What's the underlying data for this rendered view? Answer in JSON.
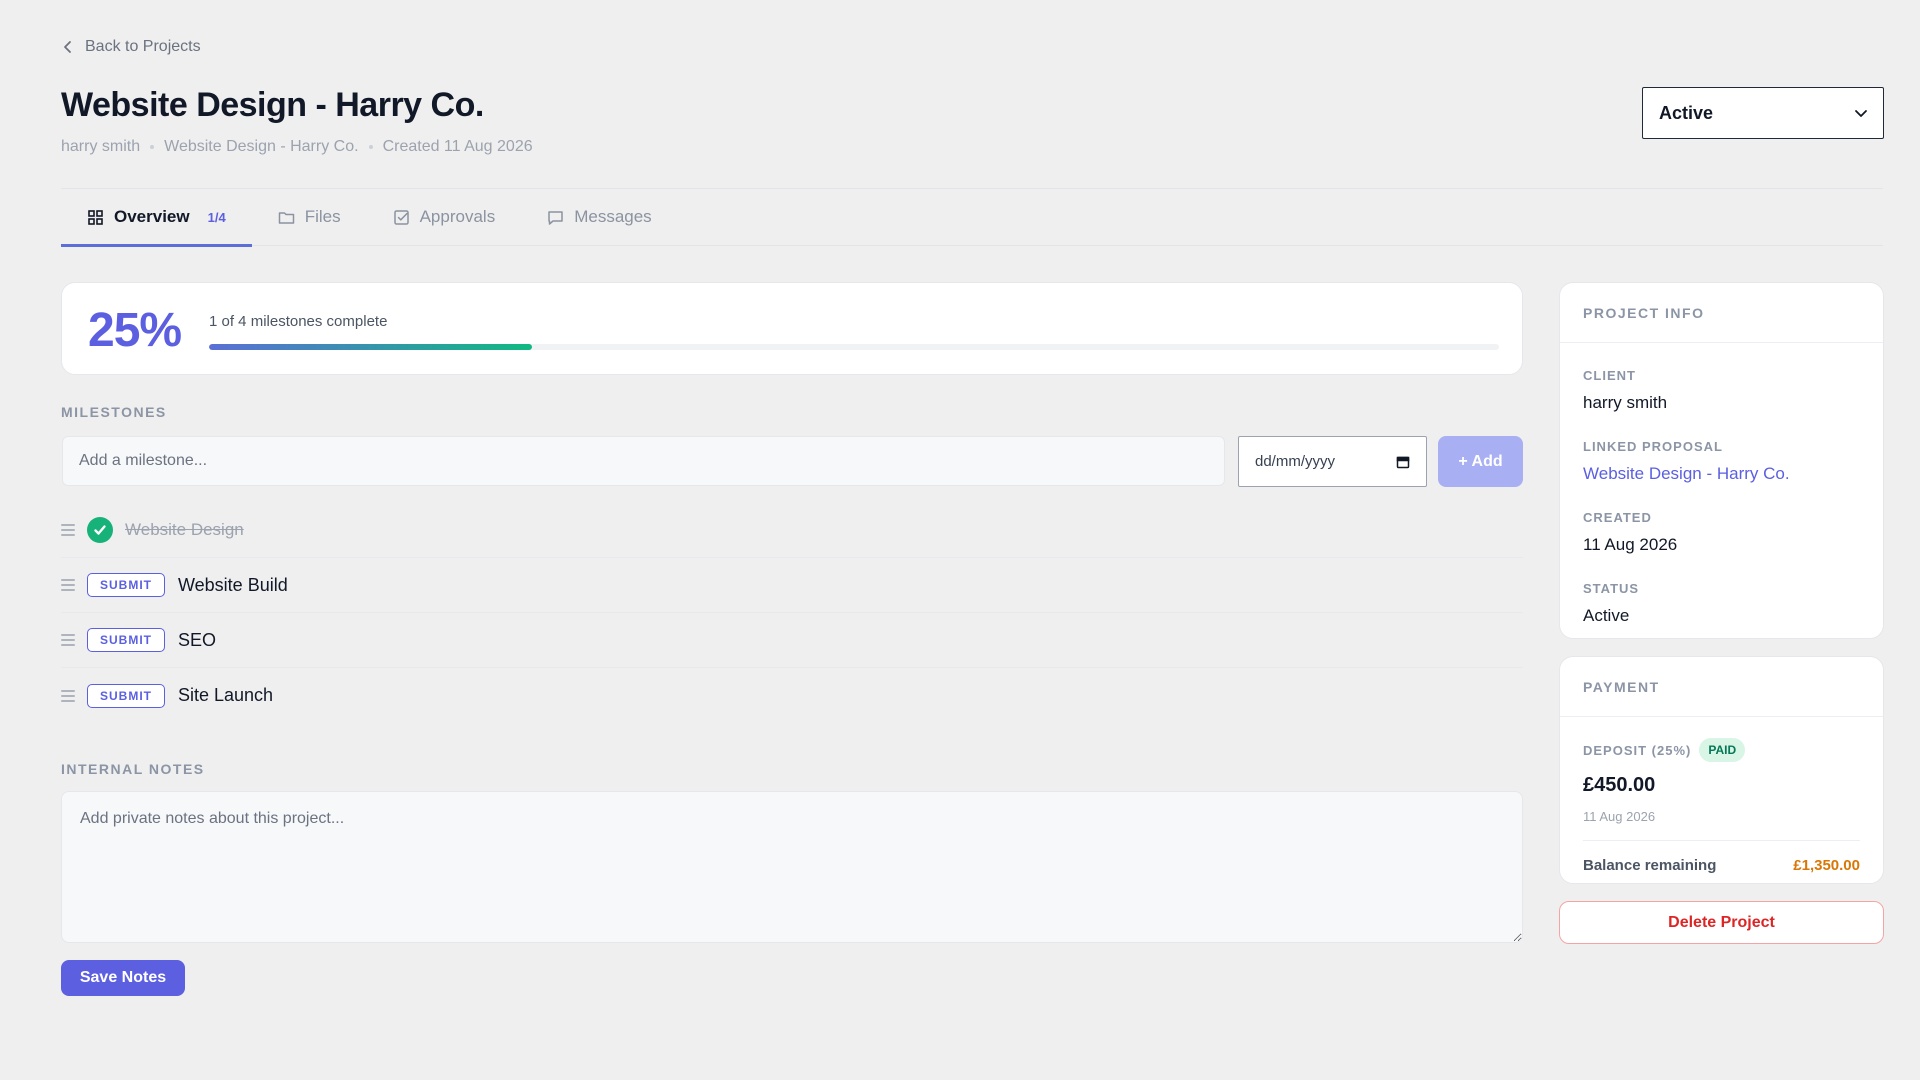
{
  "nav": {
    "back_label": "Back to Projects"
  },
  "project": {
    "title": "Website Design - Harry Co.",
    "meta_client": "harry smith",
    "meta_proposal": "Website Design - Harry Co.",
    "meta_created": "Created 11 Aug 2026",
    "status_value": "Active"
  },
  "tabs": [
    {
      "label": "Overview",
      "count": "1/4",
      "icon": "grid-icon",
      "active": true
    },
    {
      "label": "Files",
      "icon": "folder-icon"
    },
    {
      "label": "Approvals",
      "icon": "checkbox-icon"
    },
    {
      "label": "Messages",
      "icon": "message-icon"
    }
  ],
  "progress": {
    "percent_label": "25%",
    "fraction": 0.25,
    "label": "1 of 4 milestones complete",
    "colors": {
      "start": "#5b6fd6",
      "end": "#10b981"
    }
  },
  "milestones": {
    "section_label": "MILESTONES",
    "input_placeholder": "Add a milestone...",
    "date_placeholder": "dd/mm/yyyy",
    "add_label": "+ Add",
    "submit_label": "SUBMIT",
    "items": [
      {
        "name": "Website Design",
        "done": true
      },
      {
        "name": "Website Build",
        "done": false
      },
      {
        "name": "SEO",
        "done": false
      },
      {
        "name": "Site Launch",
        "done": false
      }
    ]
  },
  "notes": {
    "section_label": "INTERNAL NOTES",
    "placeholder": "Add private notes about this project...",
    "save_label": "Save Notes"
  },
  "project_info": {
    "heading": "PROJECT INFO",
    "client_label": "CLIENT",
    "client_value": "harry smith",
    "proposal_label": "LINKED PROPOSAL",
    "proposal_value": "Website Design - Harry Co.",
    "created_label": "CREATED",
    "created_value": "11 Aug 2026",
    "status_label": "STATUS",
    "status_value": "Active"
  },
  "payment": {
    "heading": "PAYMENT",
    "deposit_label": "DEPOSIT (25%)",
    "paid_badge": "PAID",
    "deposit_amount": "£450.00",
    "deposit_date": "11 Aug 2026",
    "balance_label": "Balance remaining",
    "balance_value": "£1,350.00"
  },
  "actions": {
    "delete_label": "Delete Project"
  },
  "colors": {
    "accent": "#5b5fe0",
    "success": "#16b27a",
    "warning": "#d97706",
    "danger": "#dc2626",
    "background": "#efefef"
  }
}
